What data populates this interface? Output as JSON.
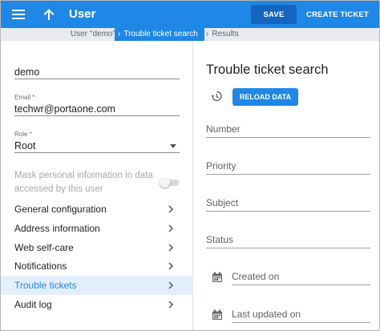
{
  "appbar": {
    "title": "User",
    "save_label": "SAVE",
    "create_label": "CREATE TICKET",
    "color": "#1f87e5"
  },
  "breadcrumb": [
    {
      "label": "User \"demo\""
    },
    {
      "label": "Trouble ticket search"
    },
    {
      "label": "Results"
    }
  ],
  "user": {
    "login": "demo",
    "email_label": "Email *",
    "email": "techwr@portaone.com",
    "role_label": "Role *",
    "role": "Root",
    "mask_label": "Mask personal information in data accessed by this user"
  },
  "nav": {
    "items": [
      {
        "label": "General configuration"
      },
      {
        "label": "Address information"
      },
      {
        "label": "Web self-care"
      },
      {
        "label": "Notifications"
      },
      {
        "label": "Trouble tickets"
      },
      {
        "label": "Audit log"
      }
    ],
    "active_index": 4
  },
  "search": {
    "title": "Trouble ticket search",
    "reload_label": "RELOAD DATA",
    "fields": {
      "number": "Number",
      "priority": "Priority",
      "subject": "Subject",
      "status": "Status",
      "created_on": "Created on",
      "last_updated_on": "Last updated on"
    }
  },
  "icons": {
    "menu": "menu-icon",
    "back": "arrow-up-icon",
    "history": "history-icon",
    "calendar": "calendar-icon",
    "chevron": "chevron-right-icon",
    "dropdown": "caret-down-icon"
  }
}
